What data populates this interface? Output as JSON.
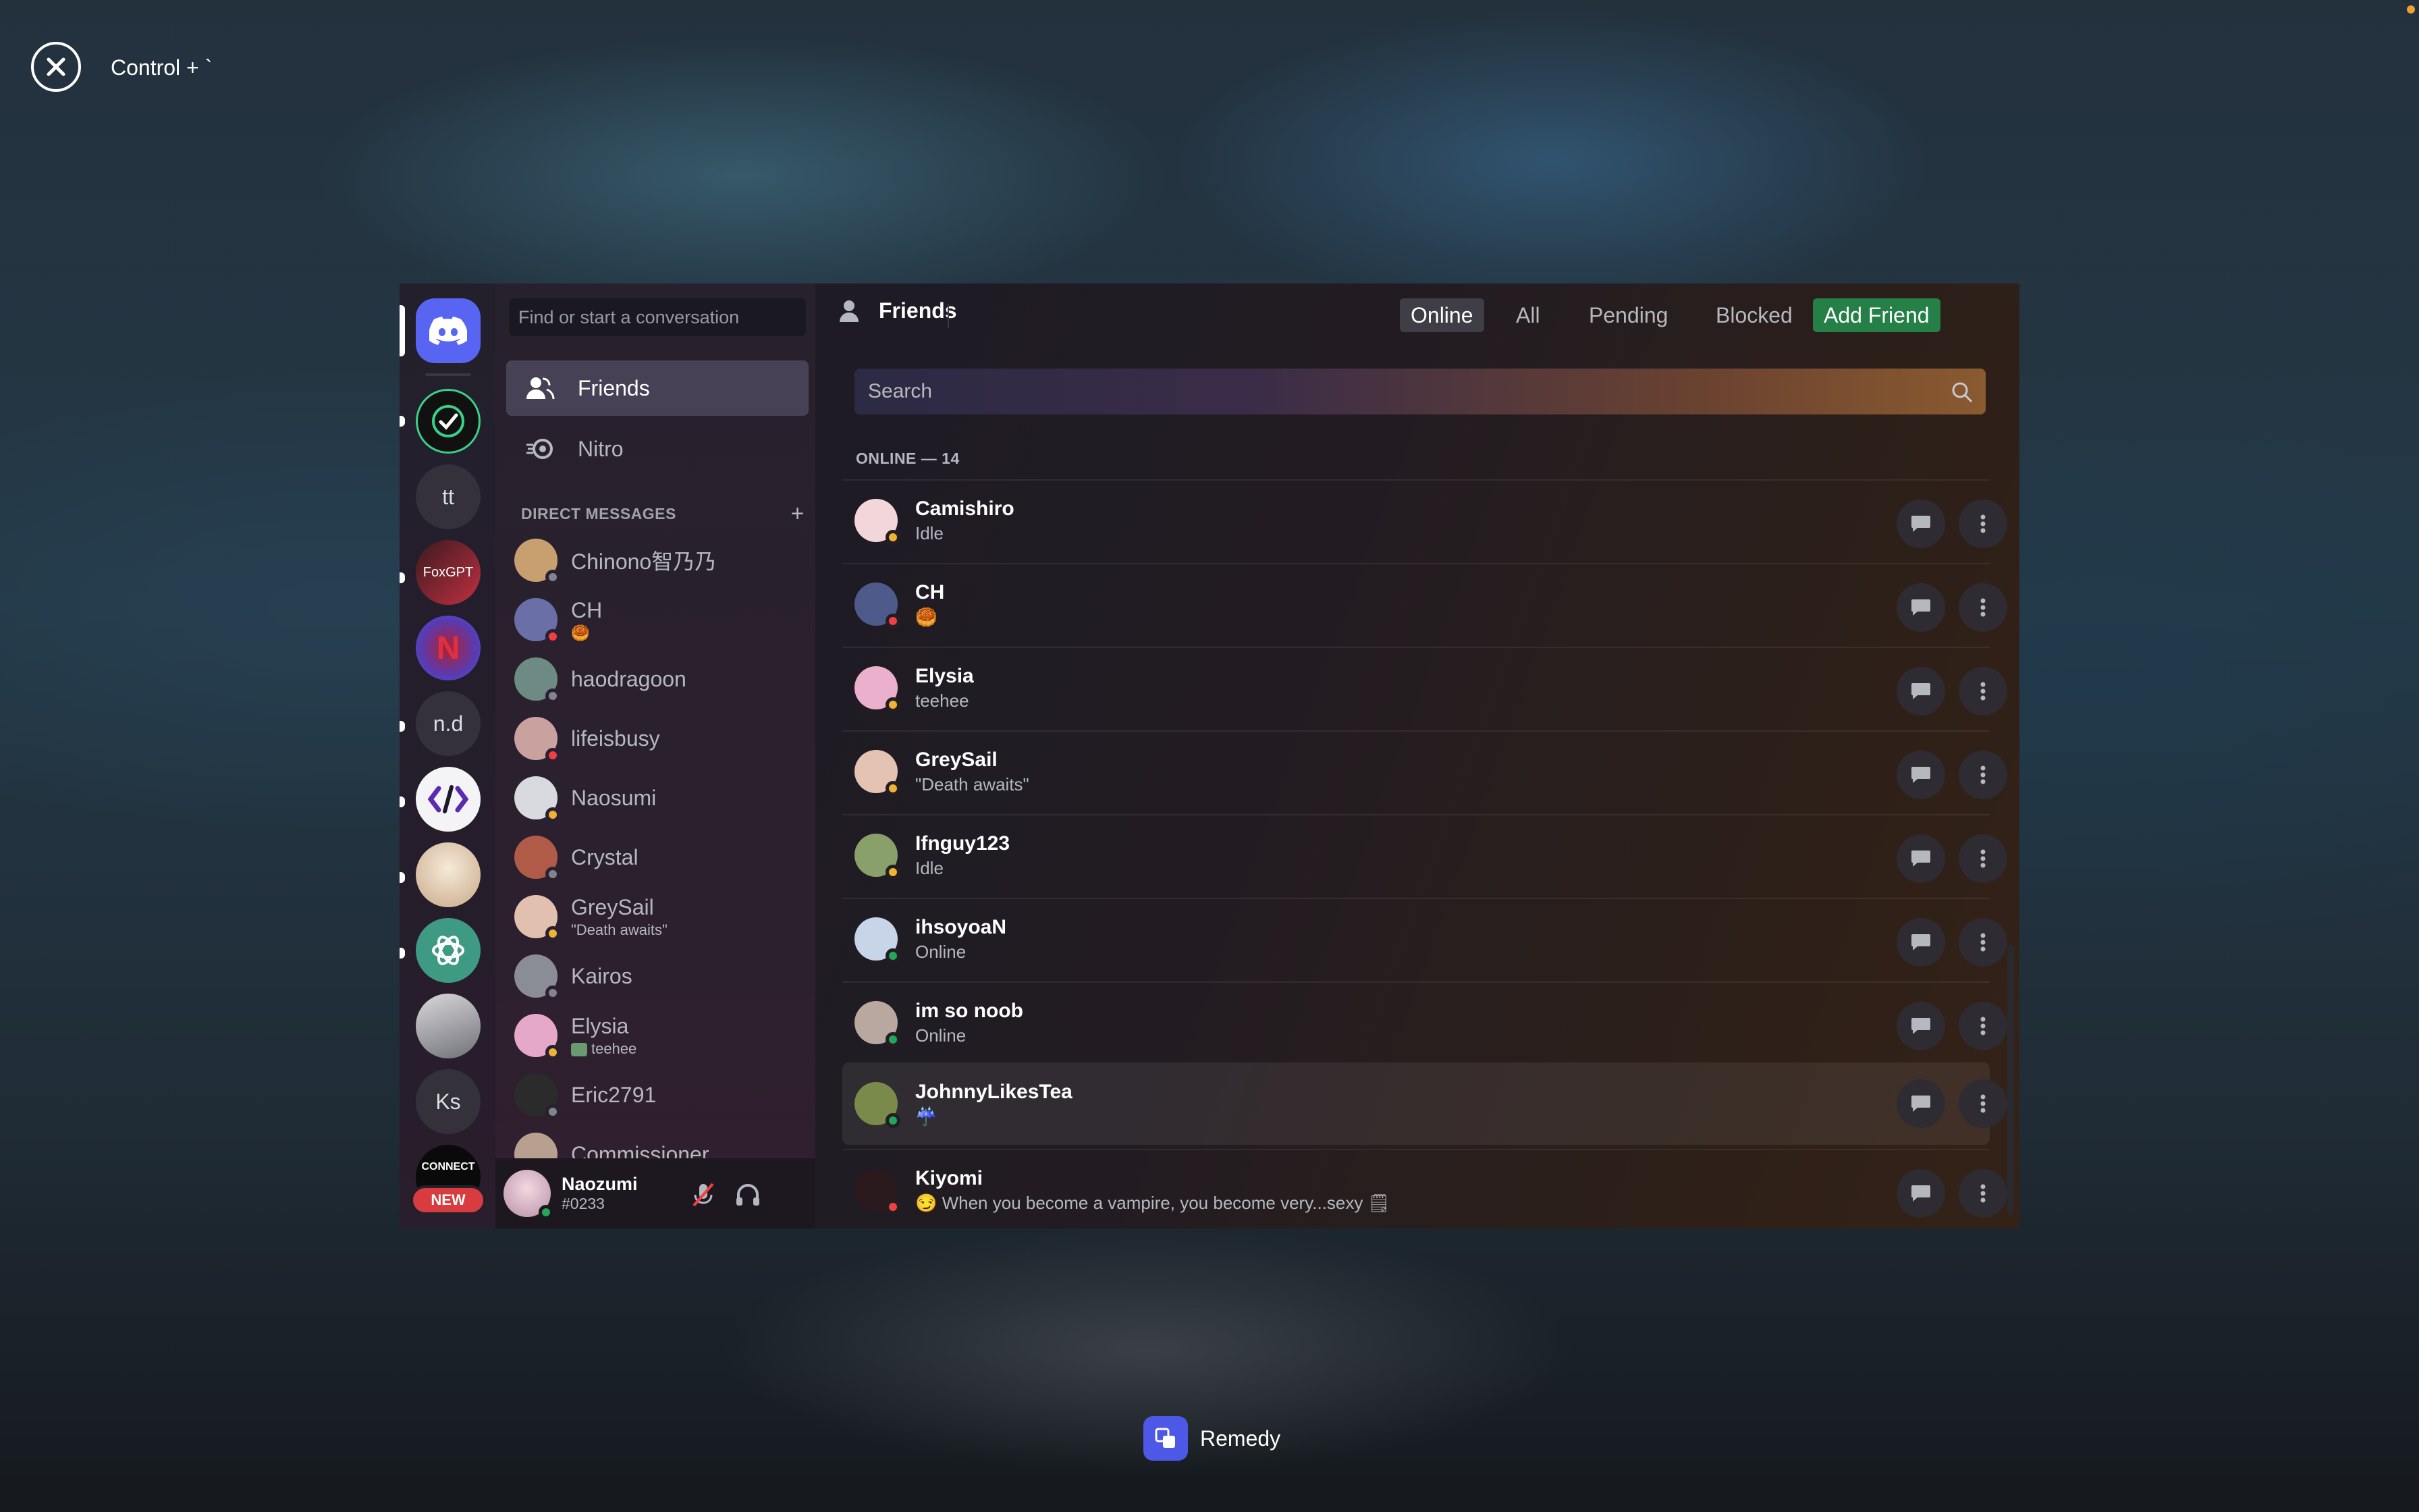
{
  "overlay": {
    "shortcut": "Control + `",
    "dock_label": "Remedy"
  },
  "guilds": [
    {
      "name": "discord-home-icon",
      "label": ""
    },
    {
      "name": "checkmark-server",
      "label": ""
    },
    {
      "name": "tt-server",
      "label": "tt"
    },
    {
      "name": "foxgpt-server",
      "label": "FoxGPT"
    },
    {
      "name": "netflix-server",
      "label": "N"
    },
    {
      "name": "nd-server",
      "label": "n.d"
    },
    {
      "name": "code-server",
      "label": "</>"
    },
    {
      "name": "anime-server",
      "label": ""
    },
    {
      "name": "chatgpt-server",
      "label": ""
    },
    {
      "name": "image-server",
      "label": ""
    },
    {
      "name": "ks-server",
      "label": "Ks"
    },
    {
      "name": "connect-server",
      "label": "CONNECT"
    }
  ],
  "new_badge": "NEW",
  "dm": {
    "search_placeholder": "Find or start a conversation",
    "friends_label": "Friends",
    "nitro_label": "Nitro",
    "section_title": "DIRECT MESSAGES",
    "items": [
      {
        "name": "Chinono智乃乃",
        "sub": "",
        "status": "offline",
        "color": "#c8a070"
      },
      {
        "name": "CH",
        "sub": "🥮",
        "status": "dnd",
        "color": "#6a6fa8"
      },
      {
        "name": "haodragoon",
        "sub": "",
        "status": "offline",
        "color": "#6e8a84"
      },
      {
        "name": "lifeisbusy",
        "sub": "",
        "status": "dnd",
        "color": "#c9a2a0"
      },
      {
        "name": "Naosumi",
        "sub": "",
        "status": "idle",
        "color": "#d8dadf"
      },
      {
        "name": "Crystal",
        "sub": "",
        "status": "offline",
        "color": "#b05a48"
      },
      {
        "name": "GreySail",
        "sub": "\"Death awaits\"",
        "status": "idle",
        "color": "#e2c0b0"
      },
      {
        "name": "Kairos",
        "sub": "",
        "status": "offline",
        "color": "#8a8c96"
      },
      {
        "name": "Elysia",
        "sub": "teehee",
        "status": "idle",
        "color": "#e6a8c8"
      },
      {
        "name": "Eric2791",
        "sub": "",
        "status": "offline",
        "color": "#2b2b2b"
      },
      {
        "name": "Commissioner",
        "sub": "",
        "status": "offline",
        "color": "#b8a090"
      }
    ]
  },
  "user": {
    "name": "Naozumi",
    "tag": "#0233",
    "status": "online"
  },
  "topbar": {
    "title": "Friends",
    "tabs": [
      "Online",
      "All",
      "Pending",
      "Blocked"
    ],
    "add_friend": "Add Friend"
  },
  "main": {
    "search_placeholder": "Search",
    "online_count": "ONLINE — 14",
    "friends": [
      {
        "name": "Camishiro",
        "status_text": "Idle",
        "status": "idle",
        "color": "#f2d6da"
      },
      {
        "name": "CH",
        "status_text": "🥮",
        "status": "dnd",
        "color": "#4d5a8a"
      },
      {
        "name": "Elysia",
        "status_text": "teehee",
        "status": "idle",
        "color": "#eab0cc"
      },
      {
        "name": "GreySail",
        "status_text": "\"Death awaits\"",
        "status": "idle",
        "color": "#e4c3b3"
      },
      {
        "name": "Ifnguy123",
        "status_text": "Idle",
        "status": "idle",
        "color": "#8aa06a"
      },
      {
        "name": "ihsoyoaN",
        "status_text": "Online",
        "status": "online",
        "color": "#c8d4e8"
      },
      {
        "name": "im so noob",
        "status_text": "Online",
        "status": "online",
        "color": "#b8a8a0"
      },
      {
        "name": "JohnnyLikesTea",
        "status_text": "☔",
        "status": "online",
        "color": "#7a8a4a"
      },
      {
        "name": "Kiyomi",
        "status_text": "😏 When you become a vampire, you become very...sexy 🗒",
        "status": "dnd",
        "color": "#2a1a1e"
      }
    ]
  }
}
